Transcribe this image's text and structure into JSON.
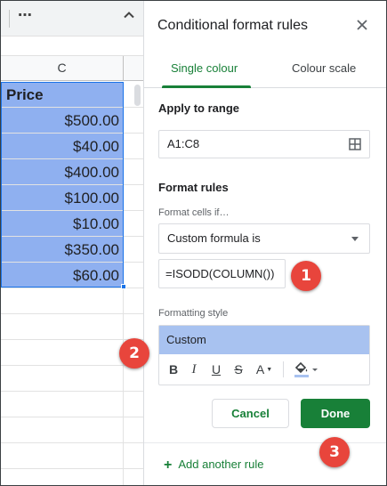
{
  "spreadsheet": {
    "toolbar": {
      "more_label": "⋯"
    },
    "column_header": "C",
    "header_cell": "Price",
    "values": [
      "$500.00",
      "$40.00",
      "$400.00",
      "$100.00",
      "$10.00",
      "$350.00",
      "$60.00"
    ],
    "selection_color": "#8fb0f0"
  },
  "panel": {
    "title": "Conditional format rules",
    "tabs": [
      {
        "label": "Single colour",
        "active": true
      },
      {
        "label": "Colour scale",
        "active": false
      }
    ],
    "apply_to_range": {
      "label": "Apply to range",
      "value": "A1:C8"
    },
    "format_rules": {
      "label": "Format rules",
      "condition_label": "Format cells if…",
      "condition_value": "Custom formula is",
      "formula_value": "=ISODD(COLUMN())"
    },
    "formatting_style": {
      "label": "Formatting style",
      "preview_text": "Custom",
      "preview_color": "#a8c2f0",
      "buttons": {
        "bold": "B",
        "italic": "I",
        "underline": "U",
        "strikethrough": "S",
        "text_color": "A"
      }
    },
    "cancel_label": "Cancel",
    "done_label": "Done",
    "add_rule_label": "Add another rule",
    "add_rule_icon": "+"
  },
  "steps": [
    "1",
    "2",
    "3"
  ],
  "colors": {
    "accent": "#188038",
    "step_marker": "#e8453c"
  }
}
